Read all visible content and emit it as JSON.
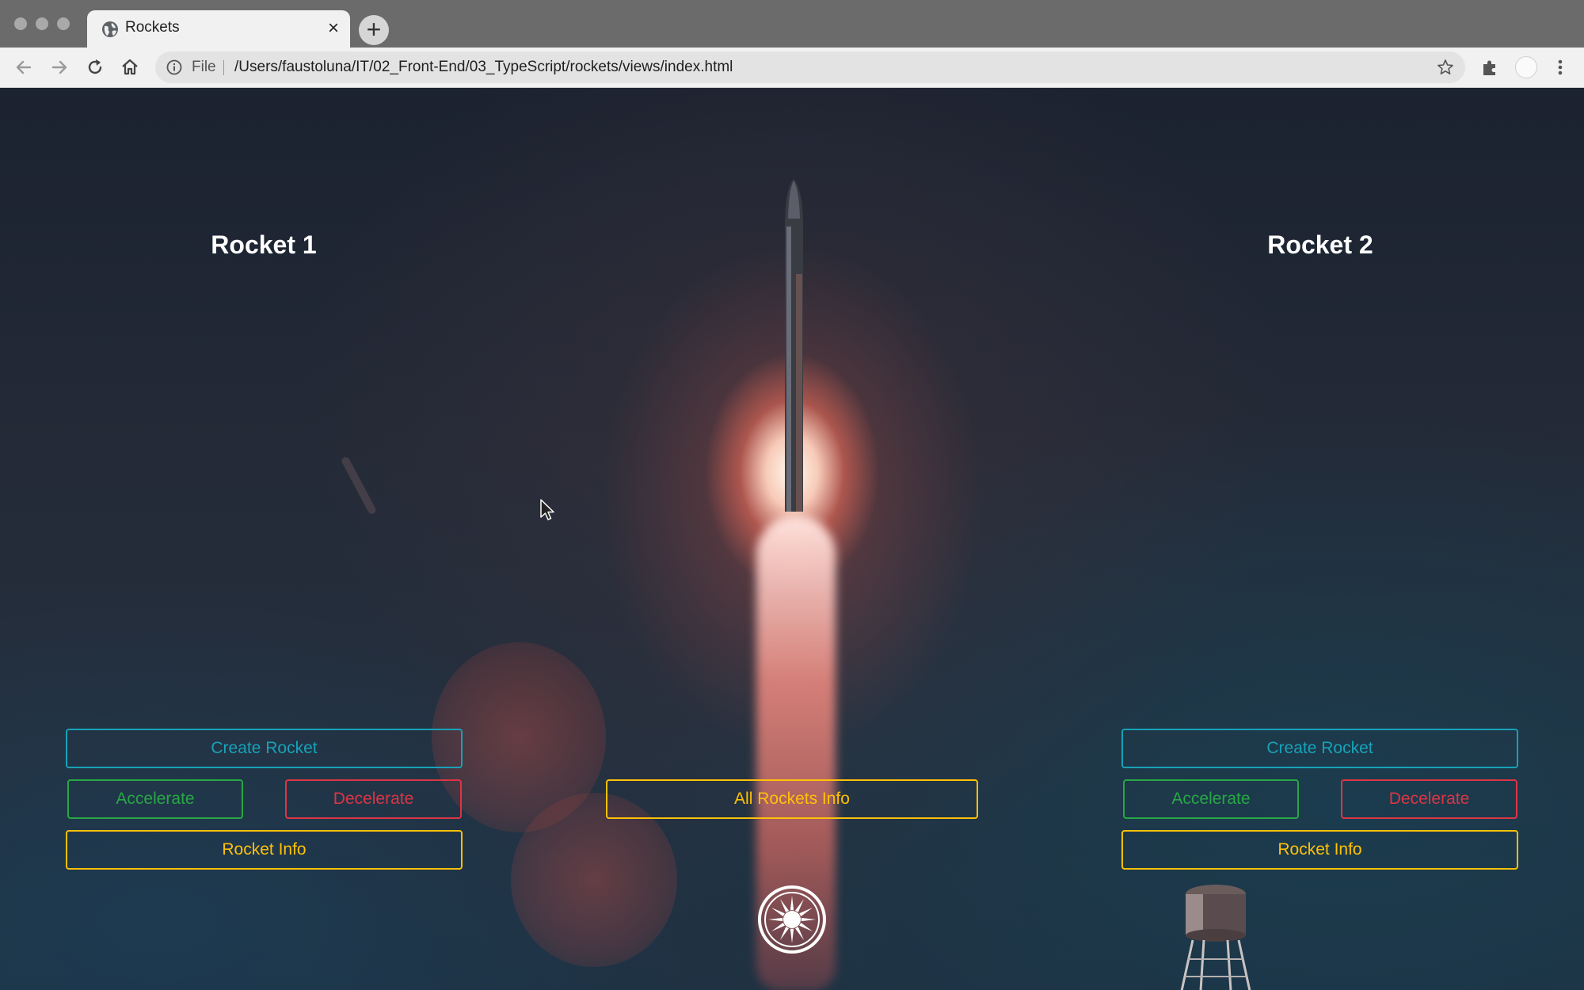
{
  "browser": {
    "tab_title": "Rockets",
    "tab_close": "×",
    "new_tab": "+",
    "address_scheme_label": "File",
    "url": "/Users/faustoluna/IT/02_Front-End/03_TypeScript/rockets/views/index.html",
    "icons": [
      "globe-icon",
      "back-arrow-icon",
      "forward-arrow-icon",
      "reload-icon",
      "home-icon",
      "info-icon",
      "star-icon",
      "puzzle-icon",
      "profile-icon",
      "kebab-menu-icon"
    ]
  },
  "rocket1": {
    "title": "Rocket 1",
    "create_label": "Create Rocket",
    "accelerate_label": "Accelerate",
    "decelerate_label": "Decelerate",
    "info_label": "Rocket Info"
  },
  "rocket2": {
    "title": "Rocket 2",
    "create_label": "Create Rocket",
    "accelerate_label": "Accelerate",
    "decelerate_label": "Decelerate",
    "info_label": "Rocket Info"
  },
  "center": {
    "all_info_label": "All Rockets Info"
  },
  "colors": {
    "info": "#17a2b8",
    "success": "#28a745",
    "danger": "#dc3545",
    "warning": "#ffc107"
  }
}
